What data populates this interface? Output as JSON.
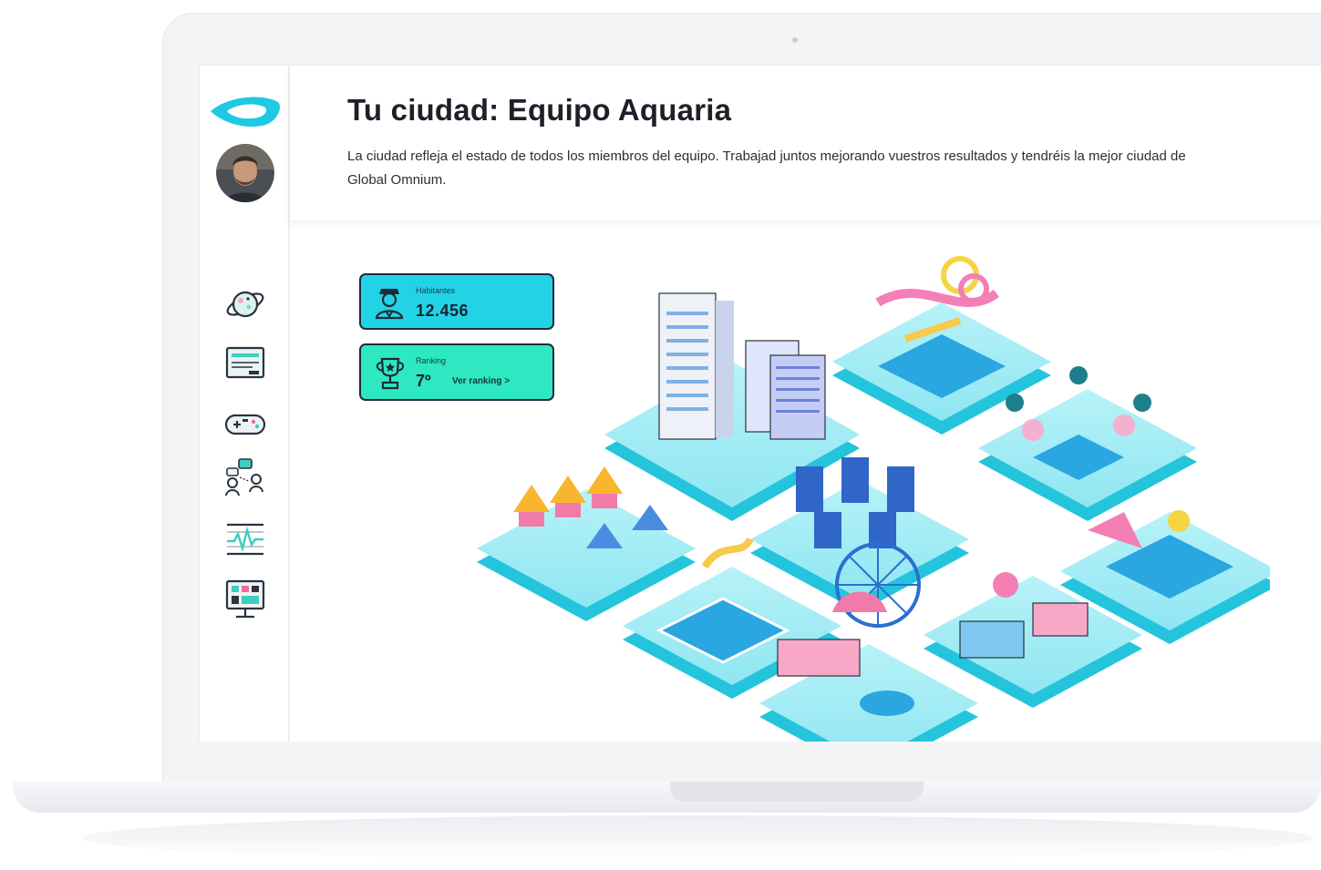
{
  "header": {
    "title": "Tu ciudad: Equipo Aquaria",
    "description": "La ciudad refleja el estado de todos los miembros del equipo. Trabajad juntos mejorando vuestros resultados y tendréis la mejor ciudad de Global Omnium."
  },
  "stats": {
    "inhabitants_label": "Habitantes",
    "inhabitants_value": "12.456",
    "ranking_label": "Ranking",
    "ranking_value": "7º",
    "ranking_link": "Ver ranking >"
  },
  "sidebar": {
    "items": [
      {
        "icon": "planet-icon"
      },
      {
        "icon": "monitor-chart-icon"
      },
      {
        "icon": "gamepad-icon"
      },
      {
        "icon": "team-chat-icon"
      },
      {
        "icon": "analytics-icon"
      },
      {
        "icon": "dashboard-screen-icon"
      }
    ]
  },
  "colors": {
    "accent_cyan": "#22d3e6",
    "accent_mint": "#2de8c0",
    "island_base": "#3fd6ea",
    "title_text": "#1e2029"
  }
}
